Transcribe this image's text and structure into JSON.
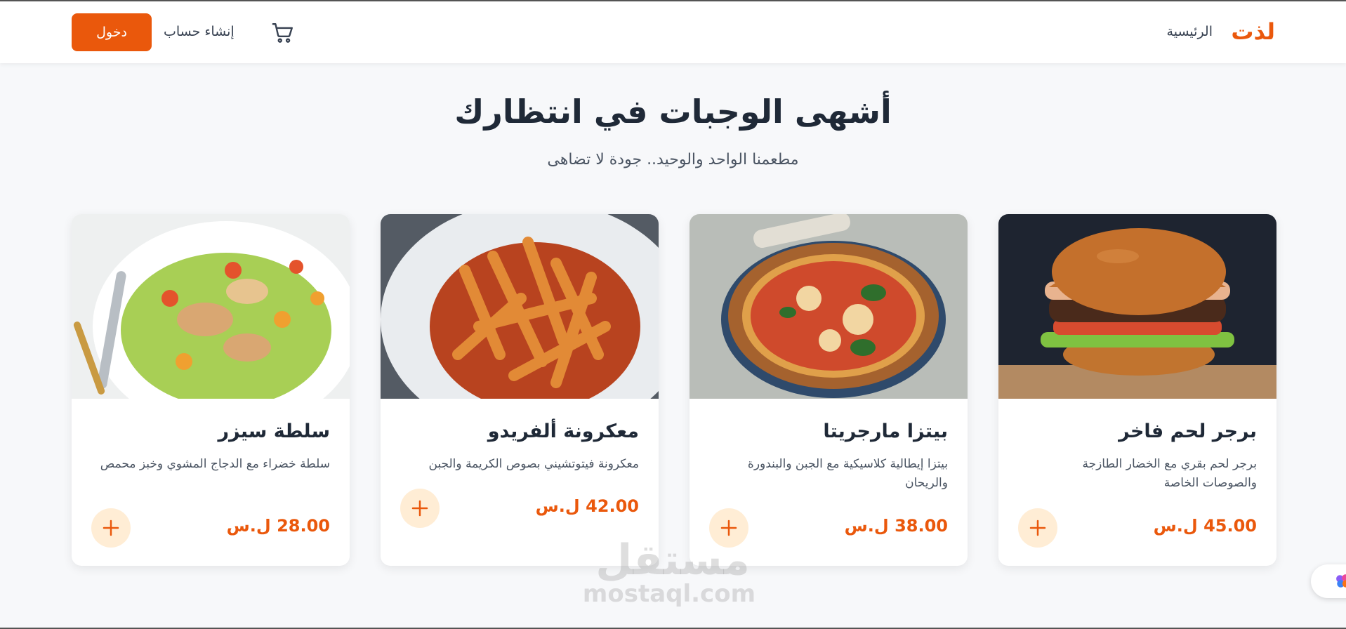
{
  "header": {
    "logo": "لذت",
    "nav_home": "الرئيسية",
    "signup_label": "إنشاء حساب",
    "login_label": "دخول",
    "cart_icon": "cart-icon"
  },
  "hero": {
    "title": "أشهى الوجبات في انتظارك",
    "subtitle": "مطعمنا الواحد والوحيد.. جودة لا تضاهى"
  },
  "menu": [
    {
      "title": "برجر لحم فاخر",
      "description": "برجر لحم بقري مع الخضار الطازجة والصوصات الخاصة",
      "price": "45.00 ل.س",
      "image": "burger"
    },
    {
      "title": "بيتزا مارجريتا",
      "description": "بيتزا إيطالية كلاسيكية مع الجبن والبندورة والريحان",
      "price": "38.00 ل.س",
      "image": "pizza"
    },
    {
      "title": "معكرونة ألفريدو",
      "description": "معكرونة فيتوتشيني بصوص الكريمة والجبن",
      "price": "42.00 ل.س",
      "image": "pasta"
    },
    {
      "title": "سلطة سيزر",
      "description": "سلطة خضراء مع الدجاج المشوي وخبز محمص",
      "price": "28.00 ل.س",
      "image": "salad"
    }
  ],
  "watermark": {
    "arabic": "مستقل",
    "latin": "mostaql.com"
  },
  "colors": {
    "accent": "#ea580c",
    "accent_light": "#ffedd5",
    "text_dark": "#1f2937",
    "background": "#f7f8fa"
  }
}
